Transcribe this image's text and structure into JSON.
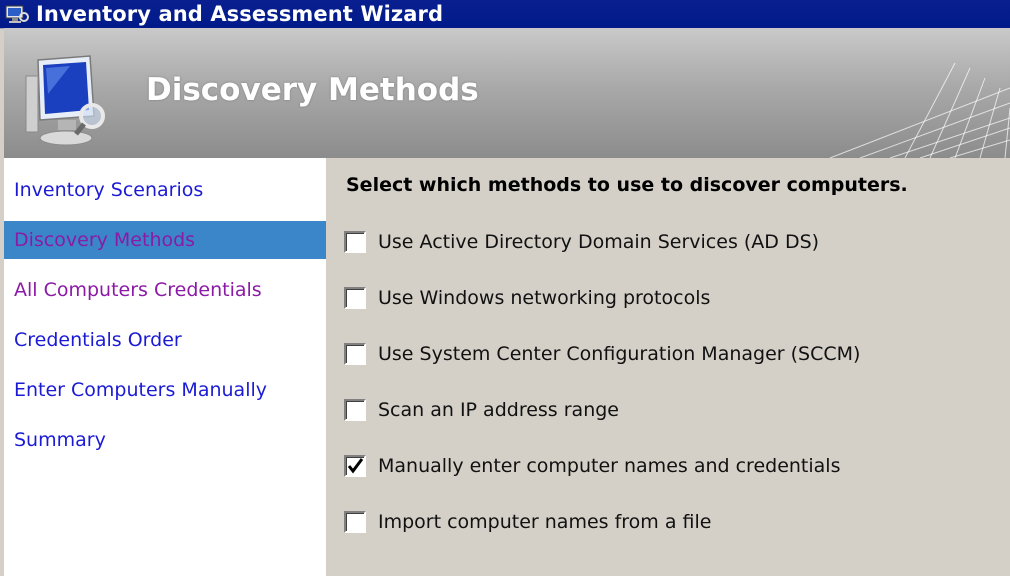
{
  "window": {
    "title": "Inventory and Assessment Wizard",
    "app_icon": "wizard-icon"
  },
  "header": {
    "title": "Discovery Methods",
    "icon": "computer-magnifier-icon"
  },
  "nav": {
    "items": [
      {
        "label": "Inventory Scenarios",
        "state": "normal"
      },
      {
        "label": "Discovery Methods",
        "state": "active"
      },
      {
        "label": "All Computers Credentials",
        "state": "visited"
      },
      {
        "label": "Credentials Order",
        "state": "normal"
      },
      {
        "label": "Enter Computers Manually",
        "state": "normal"
      },
      {
        "label": "Summary",
        "state": "normal"
      }
    ]
  },
  "content": {
    "instruction": "Select which methods to use to discover computers.",
    "options": [
      {
        "label": "Use Active Directory Domain Services (AD DS)",
        "checked": false
      },
      {
        "label": "Use Windows networking protocols",
        "checked": false
      },
      {
        "label": "Use System Center Configuration Manager (SCCM)",
        "checked": false
      },
      {
        "label": "Scan an IP address range",
        "checked": false
      },
      {
        "label": "Manually enter computer names and credentials",
        "checked": true
      },
      {
        "label": "Import computer names from a file",
        "checked": false
      }
    ]
  },
  "colors": {
    "titlebar": "#0a1f8f",
    "nav_link": "#1b1bd6",
    "nav_visited": "#8b1aa6",
    "nav_active_bg": "#3b86c8",
    "panel_bg": "#d4d0c8"
  }
}
